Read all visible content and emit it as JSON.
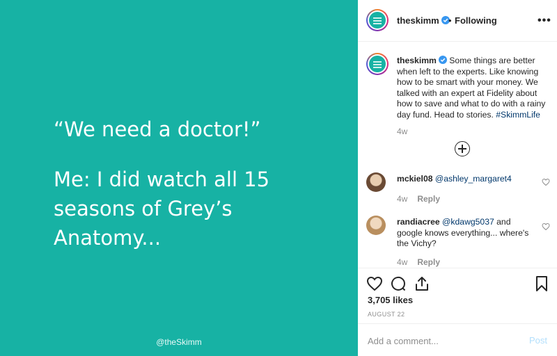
{
  "media": {
    "quote_line_1": "“We need a doctor!”",
    "quote_line_2": "Me: I did watch all 15",
    "quote_line_3": "seasons of Grey’s",
    "quote_line_4": "Anatomy...",
    "watermark": "@theSkimm",
    "background_color": "#17b2a4"
  },
  "header": {
    "username": "theskimm",
    "separator": "•",
    "follow_status": "Following",
    "more_label": "•••"
  },
  "caption": {
    "username": "theskimm",
    "text": "Some things are better when left to the experts. Like knowing how to be smart with your money. We talked with an expert at Fidelity about how to save and what to do with a rainy day fund. Head to stories.",
    "hashtag": "#SkimmLife",
    "time": "4w"
  },
  "comments": [
    {
      "username": "mckiel08",
      "mention": "@ashley_margaret4",
      "text": "",
      "time": "4w",
      "reply_label": "Reply"
    },
    {
      "username": "randiacree",
      "mention": "@kdawg5037",
      "text": "and google knows everything... where's the Vichy?",
      "time": "4w",
      "reply_label": "Reply"
    }
  ],
  "actions": {
    "likes": "3,705 likes",
    "date": "AUGUST 22"
  },
  "add_comment": {
    "placeholder": "Add a comment...",
    "post_label": "Post"
  },
  "icons": [
    "verified-badge-icon",
    "more-options-icon",
    "load-more-comments-icon",
    "heart-icon",
    "comment-icon",
    "share-icon",
    "bookmark-icon"
  ],
  "colors": {
    "accent_link": "#00376b",
    "post_button_disabled": "#b2dffc",
    "verified": "#3897f0"
  }
}
